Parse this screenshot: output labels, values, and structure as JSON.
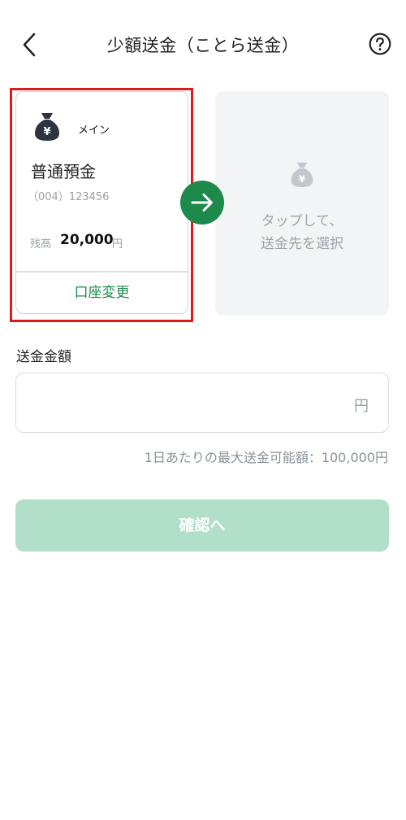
{
  "header": {
    "title": "少額送金（ことら送金）"
  },
  "source_account": {
    "tag": "メイン",
    "type": "普通預金",
    "number": "（004）123456",
    "balance_label": "残高",
    "balance": "20,000",
    "balance_unit": "円",
    "change_label": "口座変更"
  },
  "destination": {
    "prompt_line1": "タップして、",
    "prompt_line2": "送金先を選択"
  },
  "amount": {
    "label": "送金金額",
    "value": "",
    "unit": "円",
    "limit_text": "1日あたりの最大送金可能額：100,000円"
  },
  "confirm_label": "確認へ",
  "colors": {
    "accent": "#1d8a4c",
    "highlight": "#e01a1a",
    "disabled_button": "#b2dfca"
  }
}
